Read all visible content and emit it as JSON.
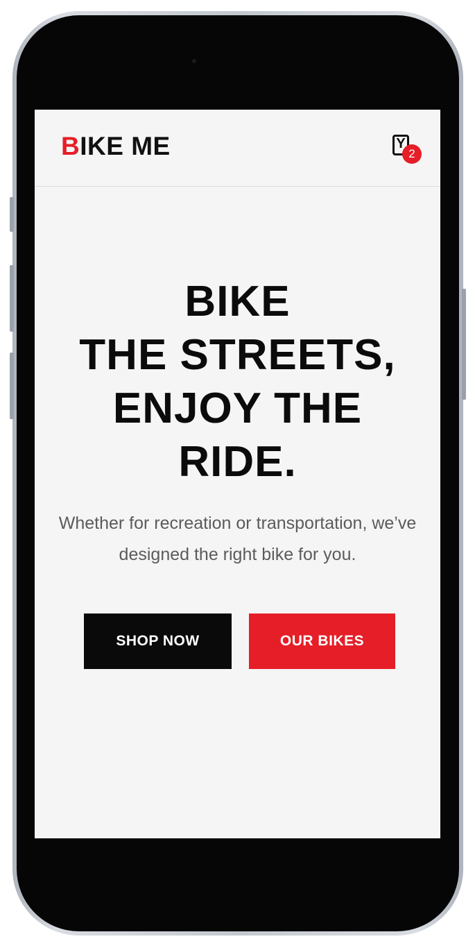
{
  "header": {
    "logo_first_letter": "B",
    "logo_rest": "IKE ME",
    "cart_count": "2"
  },
  "hero": {
    "title_lines": [
      "BIKE",
      "THE STREETS,",
      "ENJOY THE",
      "RIDE."
    ],
    "description": "Whether for recreation or transportation, we’ve designed the right bike for you.",
    "buttons": {
      "shop_now": "SHOP NOW",
      "our_bikes": "OUR BIKES"
    }
  },
  "colors": {
    "accent": "#e51e27",
    "dark": "#0a0a0a",
    "background": "#f5f5f5"
  },
  "icons": {
    "cart": "cart-icon"
  }
}
